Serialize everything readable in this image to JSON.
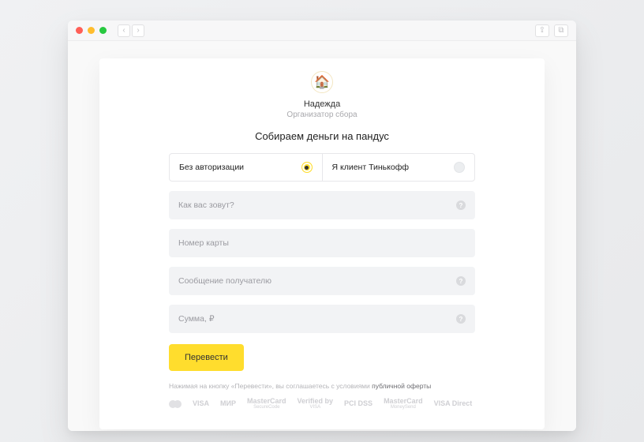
{
  "chrome": {
    "share_icon": "⇪",
    "tabs_icon": "⧉"
  },
  "profile": {
    "avatar_emoji": "🏠",
    "name": "Надежда",
    "role": "Организатор сбора"
  },
  "title": "Собираем деньги на пандус",
  "auth_toggle": {
    "options": [
      {
        "label": "Без авторизации",
        "selected": true
      },
      {
        "label": "Я клиент Тинькофф",
        "selected": false
      }
    ]
  },
  "fields": {
    "name": {
      "placeholder": "Как вас зовут?",
      "help": true
    },
    "card": {
      "placeholder": "Номер карты",
      "help": false
    },
    "message": {
      "placeholder": "Сообщение получателю",
      "help": true
    },
    "amount": {
      "placeholder": "Сумма, ₽",
      "help": true
    }
  },
  "submit_label": "Перевести",
  "disclaimer": {
    "prefix": "Нажимая на кнопку «Перевести», вы соглашаетесь с условиями ",
    "link": "публичной оферты"
  },
  "payment_logos": {
    "visa": "VISA",
    "mir": "МИР",
    "mcsc": "MasterCard",
    "mcsc_sub": "SecureCode",
    "verified": "Verified by",
    "verified_sub": "VISA",
    "pci": "PCI DSS",
    "msend": "MasterCard",
    "msend_sub": "MoneySend",
    "vdirect": "VISA Direct"
  }
}
